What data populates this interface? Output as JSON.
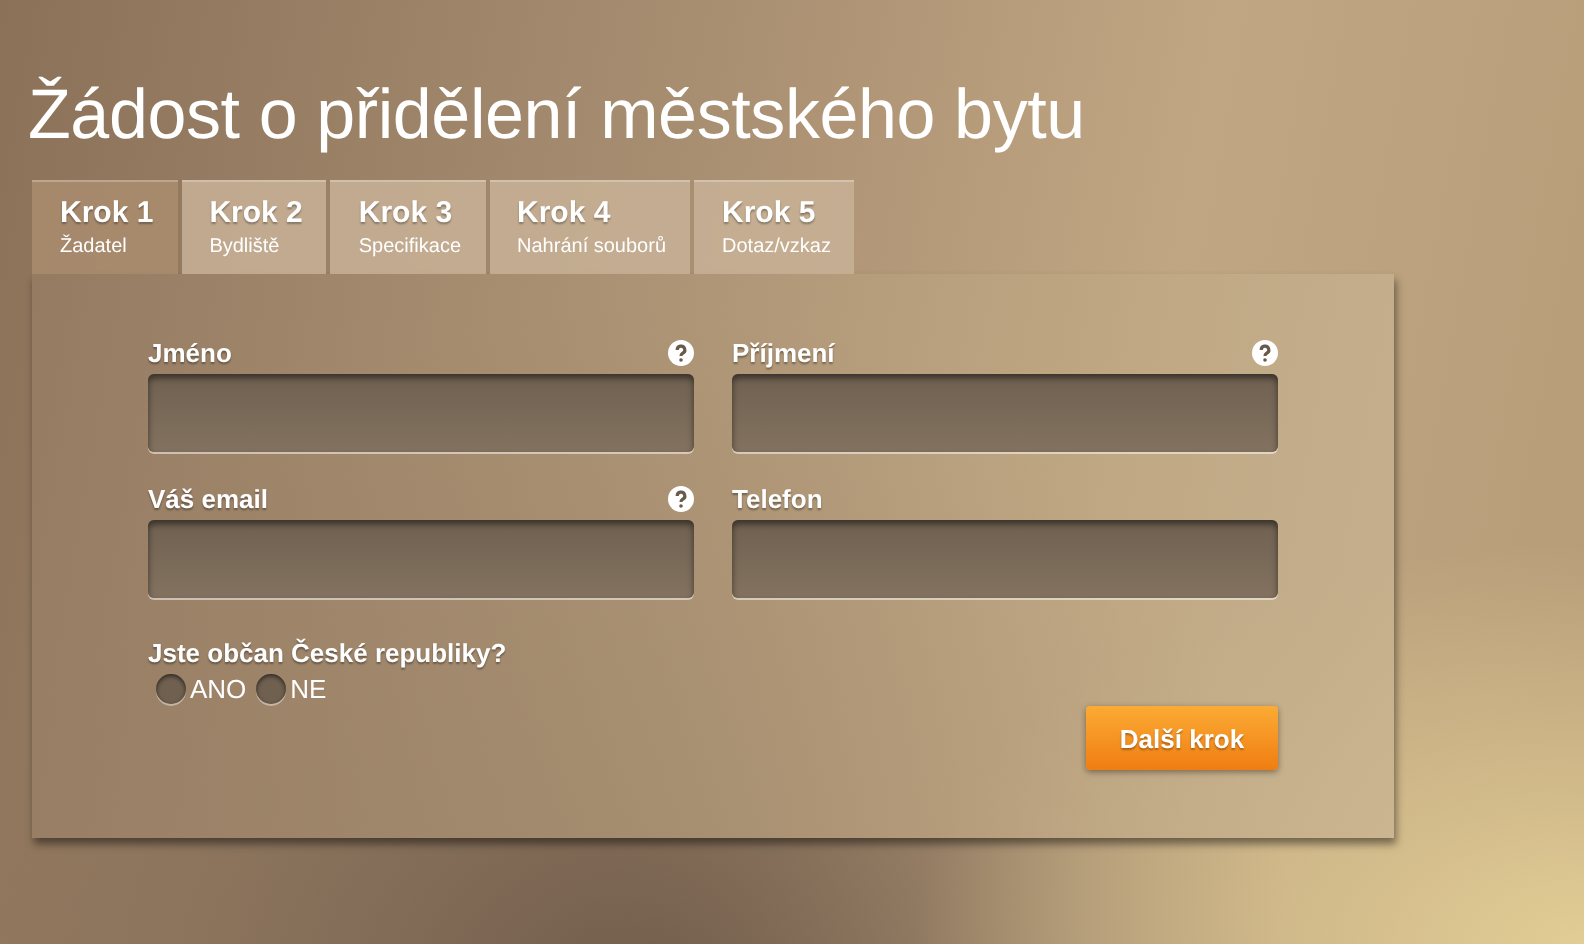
{
  "title": "Žádost o přidělení městského bytu",
  "tabs": [
    {
      "label": "Krok 1",
      "sublabel": "Žadatel",
      "selected": true
    },
    {
      "label": "Krok 2",
      "sublabel": "Bydliště",
      "selected": false
    },
    {
      "label": "Krok 3",
      "sublabel": "Specifikace",
      "selected": false
    },
    {
      "label": "Krok 4",
      "sublabel": "Nahrání souborů",
      "selected": false
    },
    {
      "label": "Krok 5",
      "sublabel": "Dotaz/vzkaz",
      "selected": false
    }
  ],
  "fields": [
    {
      "label": "Jméno",
      "help": true
    },
    {
      "label": "Příjmení",
      "help": true
    },
    {
      "label": "Váš email",
      "help": true
    },
    {
      "label": "Telefon",
      "help": false
    }
  ],
  "citizenship": {
    "question": "Jste občan České republiky?",
    "options": [
      {
        "label": "ANO",
        "selected": false
      },
      {
        "label": "NE",
        "selected": false
      }
    ]
  },
  "next_button": "Další krok"
}
